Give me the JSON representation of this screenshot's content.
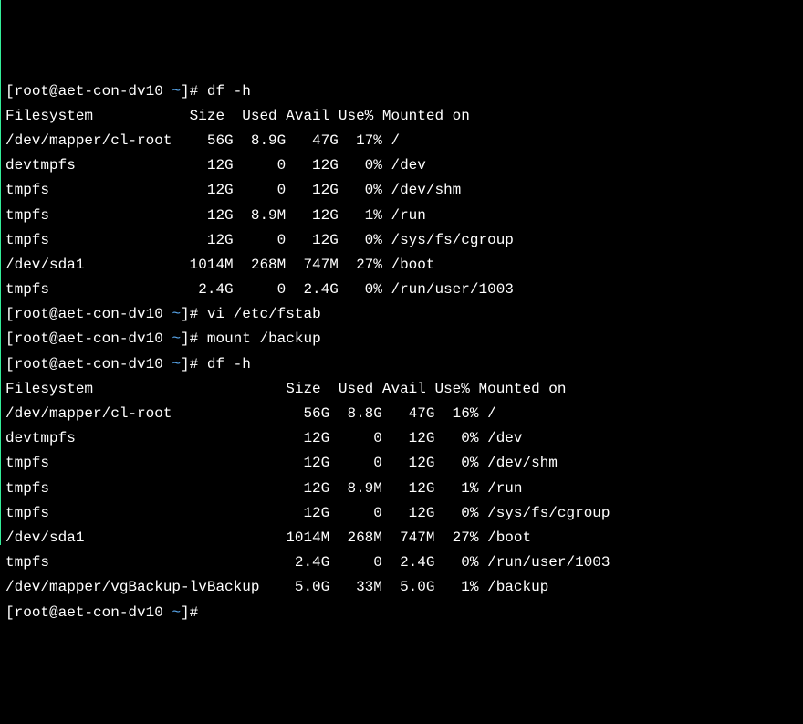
{
  "prompt": {
    "open": "[",
    "user": "root@aet-con-dv10",
    "path": " ~",
    "close": "]# "
  },
  "cmd": {
    "dfh": "df -h",
    "vi": "vi /etc/fstab",
    "mount": "mount /backup",
    "empty": ""
  },
  "df1": {
    "header": "Filesystem           Size  Used Avail Use% Mounted on",
    "rows": [
      {
        "fs": "/dev/mapper/cl-root",
        "size": "56G",
        "used": "8.9G",
        "avail": "47G",
        "use": "17%",
        "mount": "/"
      },
      {
        "fs": "devtmpfs",
        "size": "12G",
        "used": "0",
        "avail": "12G",
        "use": "0%",
        "mount": "/dev"
      },
      {
        "fs": "tmpfs",
        "size": "12G",
        "used": "0",
        "avail": "12G",
        "use": "0%",
        "mount": "/dev/shm"
      },
      {
        "fs": "tmpfs",
        "size": "12G",
        "used": "8.9M",
        "avail": "12G",
        "use": "1%",
        "mount": "/run"
      },
      {
        "fs": "tmpfs",
        "size": "12G",
        "used": "0",
        "avail": "12G",
        "use": "0%",
        "mount": "/sys/fs/cgroup"
      },
      {
        "fs": "/dev/sda1",
        "size": "1014M",
        "used": "268M",
        "avail": "747M",
        "use": "27%",
        "mount": "/boot"
      },
      {
        "fs": "tmpfs",
        "size": "2.4G",
        "used": "0",
        "avail": "2.4G",
        "use": "0%",
        "mount": "/run/user/1003"
      }
    ]
  },
  "df2": {
    "header": "Filesystem                      Size  Used Avail Use% Mounted on",
    "rows": [
      {
        "fs": "/dev/mapper/cl-root",
        "size": "56G",
        "used": "8.8G",
        "avail": "47G",
        "use": "16%",
        "mount": "/"
      },
      {
        "fs": "devtmpfs",
        "size": "12G",
        "used": "0",
        "avail": "12G",
        "use": "0%",
        "mount": "/dev"
      },
      {
        "fs": "tmpfs",
        "size": "12G",
        "used": "0",
        "avail": "12G",
        "use": "0%",
        "mount": "/dev/shm"
      },
      {
        "fs": "tmpfs",
        "size": "12G",
        "used": "8.9M",
        "avail": "12G",
        "use": "1%",
        "mount": "/run"
      },
      {
        "fs": "tmpfs",
        "size": "12G",
        "used": "0",
        "avail": "12G",
        "use": "0%",
        "mount": "/sys/fs/cgroup"
      },
      {
        "fs": "/dev/sda1",
        "size": "1014M",
        "used": "268M",
        "avail": "747M",
        "use": "27%",
        "mount": "/boot"
      },
      {
        "fs": "tmpfs",
        "size": "2.4G",
        "used": "0",
        "avail": "2.4G",
        "use": "0%",
        "mount": "/run/user/1003"
      },
      {
        "fs": "/dev/mapper/vgBackup-lvBackup",
        "size": "5.0G",
        "used": "33M",
        "avail": "5.0G",
        "use": "1%",
        "mount": "/backup"
      }
    ]
  },
  "colwidths": {
    "df1": {
      "fs": 20,
      "size": 6,
      "used": 6,
      "avail": 6,
      "use": 5
    },
    "df2": {
      "fs": 31,
      "size": 6,
      "used": 6,
      "avail": 6,
      "use": 5
    }
  }
}
